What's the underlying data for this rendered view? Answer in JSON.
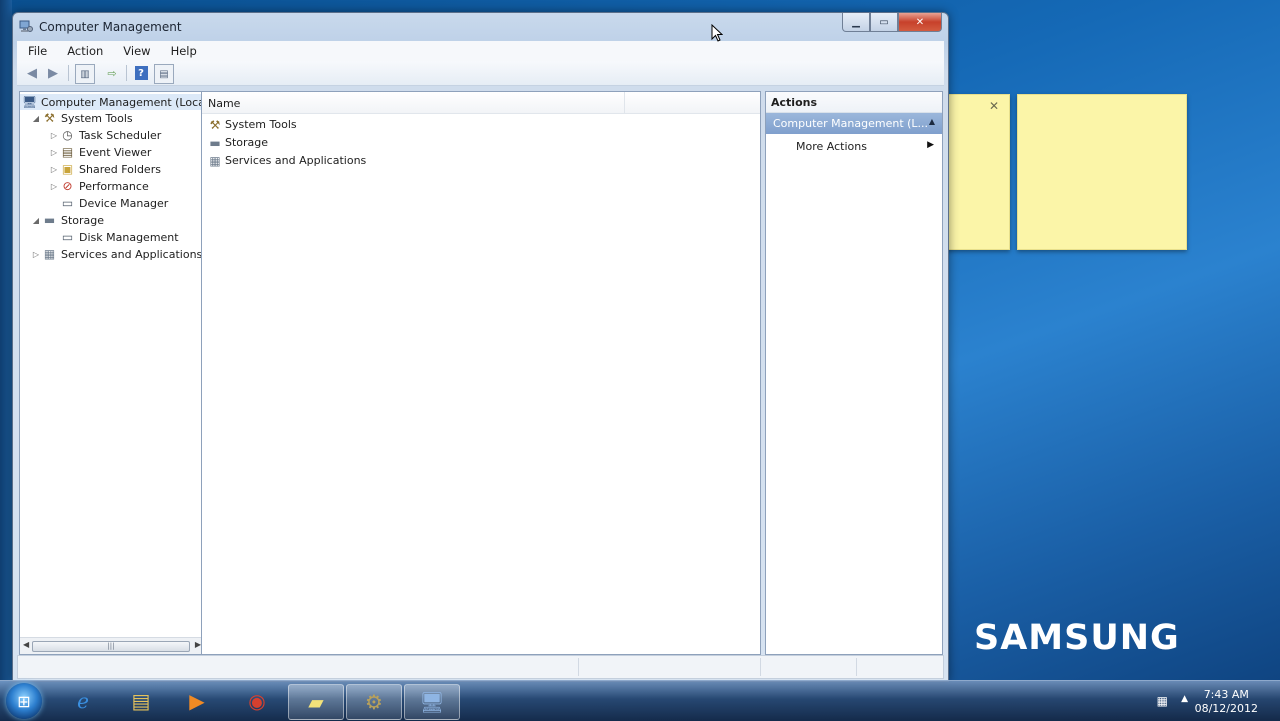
{
  "window": {
    "title": "Computer Management",
    "menu": [
      "File",
      "Action",
      "View",
      "Help"
    ]
  },
  "tree": {
    "items": [
      {
        "label": "Computer Management (Local",
        "icon": "computer-management-icon",
        "level": 0,
        "expander": "",
        "selected": true
      },
      {
        "label": "System Tools",
        "icon": "tools-icon",
        "level": 1,
        "expander": "expanded"
      },
      {
        "label": "Task Scheduler",
        "icon": "clock-icon",
        "level": 2,
        "expander": "collapsed"
      },
      {
        "label": "Event Viewer",
        "icon": "event-viewer-icon",
        "level": 2,
        "expander": "collapsed"
      },
      {
        "label": "Shared Folders",
        "icon": "shared-folder-icon",
        "level": 2,
        "expander": "collapsed"
      },
      {
        "label": "Performance",
        "icon": "performance-icon",
        "level": 2,
        "expander": "collapsed"
      },
      {
        "label": "Device Manager",
        "icon": "device-manager-icon",
        "level": 2,
        "expander": ""
      },
      {
        "label": "Storage",
        "icon": "storage-icon",
        "level": 1,
        "expander": "expanded"
      },
      {
        "label": "Disk Management",
        "icon": "disk-management-icon",
        "level": 2,
        "expander": ""
      },
      {
        "label": "Services and Applications",
        "icon": "services-icon",
        "level": 1,
        "expander": "collapsed"
      }
    ]
  },
  "content": {
    "column_header": "Name",
    "items": [
      {
        "label": "System Tools",
        "icon": "tools-icon"
      },
      {
        "label": "Storage",
        "icon": "storage-icon"
      },
      {
        "label": "Services and Applications",
        "icon": "services-icon"
      }
    ]
  },
  "actions": {
    "header": "Actions",
    "section": "Computer Management (L...",
    "items": [
      {
        "label": "More Actions"
      }
    ]
  },
  "desktop": {
    "brand": "SAMSUNG"
  },
  "taskbar": {
    "apps": [
      "internet-explorer-icon",
      "windows-explorer-icon",
      "media-player-icon",
      "chrome-icon",
      "sticky-notes-icon",
      "tools-app-icon",
      "computer-management-icon"
    ],
    "active_app": "computer-management-icon",
    "time": "7:43 AM",
    "date": "08/12/2012"
  },
  "colors": {
    "accent": "#7f9fcd",
    "selection": "#dce9f8",
    "desktop": "#1569b6"
  }
}
